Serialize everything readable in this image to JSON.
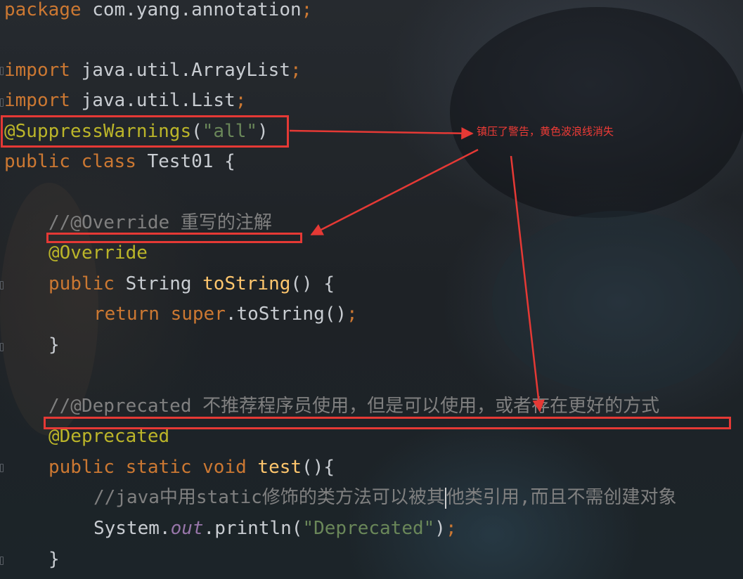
{
  "code": {
    "package_line": {
      "keyword": "package",
      "name": " com.yang.annotation",
      "semi": ";"
    },
    "import1": {
      "keyword": "import",
      "name": " java.util.ArrayList",
      "semi": ";"
    },
    "import2": {
      "keyword": "import",
      "name": " java.util.List",
      "semi": ";"
    },
    "suppress": {
      "annotation": "@SuppressWarnings",
      "open": "(",
      "value": "\"all\"",
      "close": ")"
    },
    "class_decl": {
      "public": "public",
      "class": " class",
      "name": " Test01 {"
    },
    "comment_override": "//@Override 重写的注解",
    "override": "@Override",
    "tostring_decl": {
      "public": "public",
      "type": " String ",
      "method": "toString",
      "rest": "() {"
    },
    "return_line": {
      "return": "return",
      "super": " super",
      "call": ".toString()",
      "semi": ";"
    },
    "brace1": "}",
    "comment_deprecated": "//@Deprecated 不推荐程序员使用，但是可以使用，或者存在更好的方式",
    "deprecated": "@Deprecated",
    "test_decl": {
      "public": "public",
      "static": " static",
      "void": " void ",
      "method": "test",
      "rest": "(){"
    },
    "comment_java_a": "//java中用static修饰的类方法可以被其",
    "comment_java_b": "他类引用,而且不需创建对象",
    "println": {
      "system": "System.",
      "out": "out",
      "println": ".println(",
      "str": "\"Deprecated\"",
      "close": ")",
      "semi": ";"
    },
    "brace2": "}"
  },
  "annotation_note": "镇压了警告，黄色波浪线消失",
  "colors": {
    "keyword": "#cc7832",
    "annotation": "#bbb529",
    "string": "#6a8759",
    "method": "#ffc66d",
    "comment": "#808080",
    "static_field": "#9876aa",
    "plain": "#c9cdd2",
    "markup_red": "#e53935"
  }
}
